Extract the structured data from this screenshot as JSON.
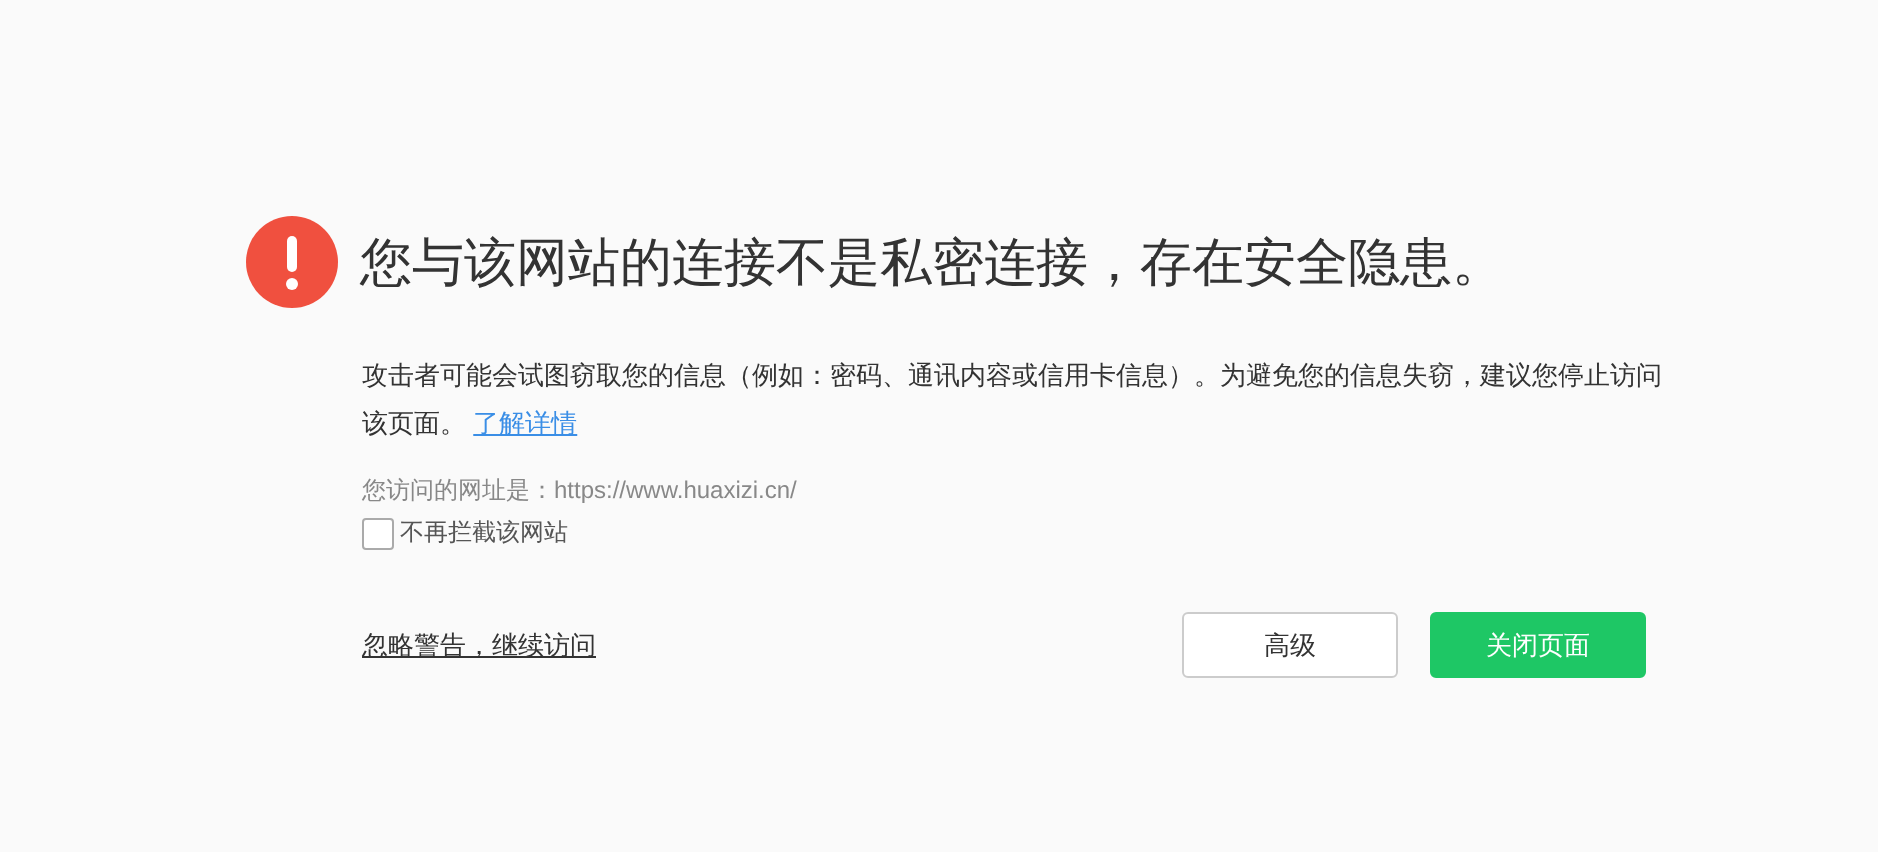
{
  "title": "您与该网站的连接不是私密连接，存在安全隐患。",
  "description": "攻击者可能会试图窃取您的信息（例如：密码、通讯内容或信用卡信息）。为避免您的信息失窃，建议您停止访问该页面。",
  "learn_more_link": "了解详情",
  "url_line": "您访问的网址是：https://www.huaxizi.cn/",
  "dont_block": {
    "label": "不再拦截该网站",
    "checked": false
  },
  "proceed_link": "忽略警告，继续访问",
  "buttons": [
    {
      "label": "高级",
      "kind": "secondary"
    },
    {
      "label": "关闭页面",
      "kind": "primary"
    }
  ]
}
